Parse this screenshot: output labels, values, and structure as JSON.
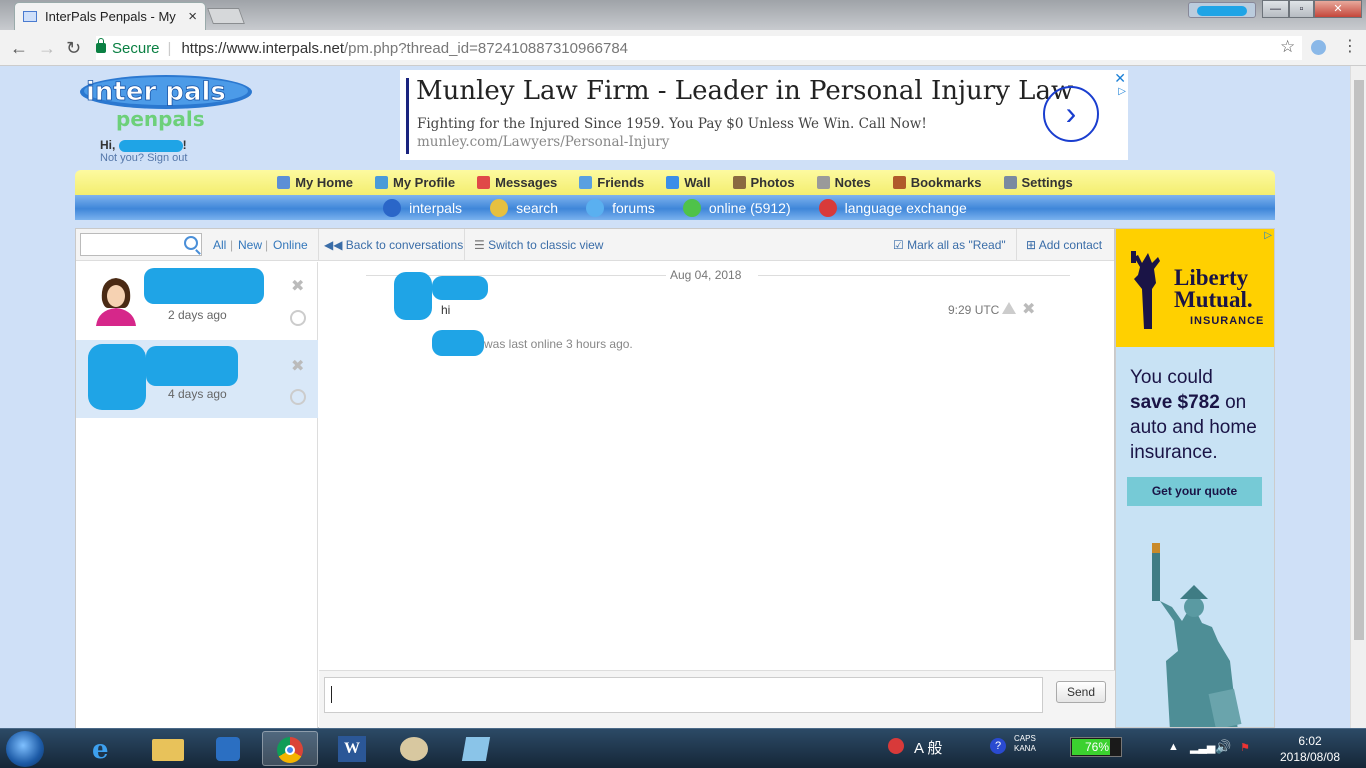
{
  "browser": {
    "tab_title": "InterPals Penpals - My",
    "tab_close": "×",
    "secure_label": "Secure",
    "url_host": "https://www.interpals.net",
    "url_path": "/pm.php?thread_id=872410887310966784",
    "window_buttons": [
      "—",
      "▫",
      "✕"
    ]
  },
  "header": {
    "logo_top": "inter pals",
    "logo_bottom": "penpals",
    "greeting_prefix": "Hi, ",
    "greeting_suffix": "!",
    "not_you": "Not you? Sign out"
  },
  "ad_top": {
    "headline": "Munley Law Firm - Leader in Personal Injury Law",
    "subline": "Fighting for the Injured Since 1959. You Pay $0 Unless We Win. Call Now!",
    "url": "munley.com/Lawyers/Personal-Injury",
    "go_glyph": "›",
    "close_glyph": "✕",
    "adchoices_glyph": "▷"
  },
  "menu_primary": [
    {
      "label": "My Home",
      "icon": "home-icon",
      "color": "#5b8fd6"
    },
    {
      "label": "My Profile",
      "icon": "profile-icon",
      "color": "#4a9bd8"
    },
    {
      "label": "Messages",
      "icon": "envelope-icon",
      "color": "#e04848"
    },
    {
      "label": "Friends",
      "icon": "friends-icon",
      "color": "#5aa0e0"
    },
    {
      "label": "Wall",
      "icon": "wall-icon",
      "color": "#3b8ee8"
    },
    {
      "label": "Photos",
      "icon": "photos-icon",
      "color": "#8a6a40"
    },
    {
      "label": "Notes",
      "icon": "notes-icon",
      "color": "#9a9a9a"
    },
    {
      "label": "Bookmarks",
      "icon": "bookmarks-icon",
      "color": "#b05a2a"
    },
    {
      "label": "Settings",
      "icon": "settings-icon",
      "color": "#7a8aa0"
    }
  ],
  "menu_secondary": [
    {
      "label": "interpals",
      "icon": "globe-icon",
      "color": "#2a66c8"
    },
    {
      "label": "search",
      "icon": "search-icon",
      "color": "#e6c040"
    },
    {
      "label": "forums",
      "icon": "forums-icon",
      "color": "#5ab0f0"
    },
    {
      "label": "online (5912)",
      "icon": "online-icon",
      "color": "#4fc24a"
    },
    {
      "label": "language exchange",
      "icon": "flags-icon",
      "color": "#d83a3a"
    }
  ],
  "messages_toolbar": {
    "filters": [
      "All",
      "New",
      "Online"
    ],
    "back": "Back to conversations",
    "classic": "Switch to classic view",
    "mark_read": "Mark all as \"Read\"",
    "add_contact": "Add contact",
    "search_value": ""
  },
  "conversations": [
    {
      "ago": "2 days ago",
      "selected": false
    },
    {
      "ago": "4 days ago",
      "selected": true
    }
  ],
  "thread": {
    "date": "Aug 04, 2018",
    "message_text": "hi",
    "message_time": "9:29 UTC",
    "last_online": "was last online 3 hours ago."
  },
  "compose": {
    "value": "",
    "send_label": "Send"
  },
  "ad_side": {
    "brand_line1": "Liberty",
    "brand_line2": "Mutual.",
    "brand_line3": "INSURANCE",
    "copy_line1": "You could",
    "copy_bold": "save $782",
    "copy_line2": " on",
    "copy_line3": "auto and home",
    "copy_line4": "insurance.",
    "cta": "Get your quote",
    "colors": {
      "yellow": "#ffd000",
      "navy": "#1a1446",
      "sky": "#c8e2f4",
      "button": "#76cad6"
    }
  },
  "taskbar": {
    "ime": "A 般",
    "caps": "CAPS",
    "kana": "KANA",
    "battery": "76%",
    "time": "6:02",
    "date": "2018/08/08"
  },
  "colors": {
    "menu_yellow": "#f3ee70",
    "menu_blue": "#3f86d9",
    "page_bg": "#cfe0f7",
    "link": "#3a6da8"
  }
}
